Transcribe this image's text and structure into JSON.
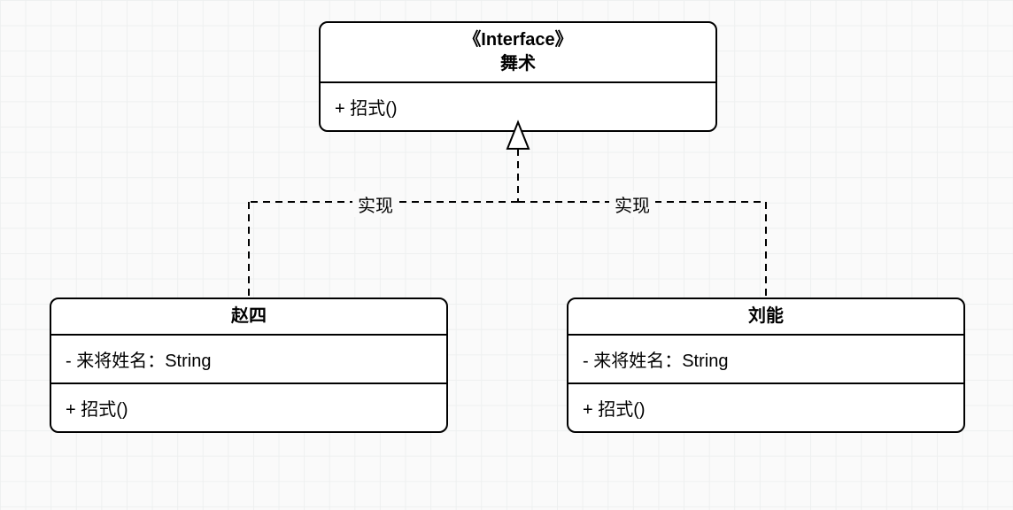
{
  "interface": {
    "stereotype": "《Interface》",
    "name": "舞术",
    "operation": "+ 招式()"
  },
  "classLeft": {
    "name": "赵四",
    "attribute": "- 来将姓名：String",
    "operation": "+ 招式()"
  },
  "classRight": {
    "name": "刘能",
    "attribute": "- 来将姓名：String",
    "operation": "+ 招式()"
  },
  "edges": {
    "left": "实现",
    "right": "实现"
  }
}
